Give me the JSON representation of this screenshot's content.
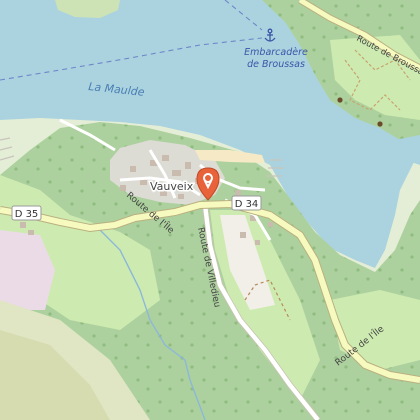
{
  "map": {
    "water_label": "La Maulde",
    "village_label": "Vauveix",
    "poi_label_line1": "Embarcadère",
    "poi_label_line2": "de Broussas",
    "road_shields": [
      "D 35",
      "D 34"
    ],
    "road_labels": {
      "route_ile_west": "Route de l'Île",
      "route_villedieu": "Route de Villedieu",
      "route_ile_east": "Route de l'Île",
      "route_broussas": "Route de Broussas"
    },
    "poi_icon": "anchor-icon",
    "marker_icon": "location-pin-icon",
    "colors": {
      "water": "#aad3df",
      "forest": "#add19e",
      "grass": "#cdebb0",
      "land": "#f2efe9",
      "road_yellow": "#f7fabf",
      "road_casing": "#b9b080",
      "marker": "#e8623a",
      "poi_text": "#3a56a8"
    }
  }
}
